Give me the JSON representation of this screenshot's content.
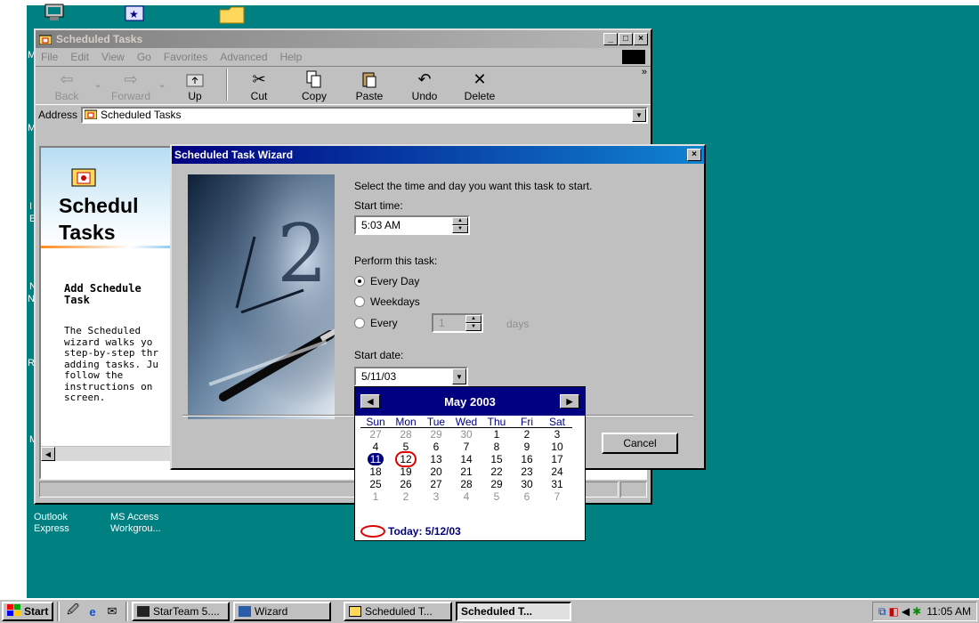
{
  "desktop": {
    "edge_labels": [
      "My",
      "My I",
      "I",
      "E",
      "N",
      "Ne",
      "Re",
      "M"
    ],
    "icons": [
      {
        "label_line1": "Outlook",
        "label_line2": "Express"
      },
      {
        "label_line1": "MS Access",
        "label_line2": "Workgrou..."
      }
    ]
  },
  "explorer": {
    "title": "Scheduled Tasks",
    "menu": [
      "File",
      "Edit",
      "View",
      "Go",
      "Favorites",
      "Advanced",
      "Help"
    ],
    "toolbar": {
      "back": "Back",
      "forward": "Forward",
      "up": "Up",
      "cut": "Cut",
      "copy": "Copy",
      "paste": "Paste",
      "undo": "Undo",
      "delete": "Delete",
      "more": "»"
    },
    "address_label": "Address",
    "address_value": "Scheduled Tasks",
    "left_pane": {
      "title_line1": "Schedul",
      "title_line2": "Tasks",
      "subtitle_line1": "Add Schedule",
      "subtitle_line2": "Task",
      "description": "The Scheduled \nwizard walks yo\nstep-by-step thr\nadding tasks. Ju\nfollow the\ninstructions on \nscreen."
    }
  },
  "wizard": {
    "title": "Scheduled Task Wizard",
    "close": "×",
    "prompt": "Select the time and day you want this task to start.",
    "start_time_label": "Start time:",
    "start_time_value": "5:03 AM",
    "perform_label": "Perform this task:",
    "options": [
      {
        "label": "Every Day",
        "checked": true
      },
      {
        "label": "Weekdays",
        "checked": false
      },
      {
        "label": "Every",
        "checked": false
      }
    ],
    "every_value": "1",
    "every_unit": "days",
    "start_date_label": "Start date:",
    "start_date_value": "5/11/03",
    "cancel_label": "Cancel"
  },
  "calendar": {
    "month_label": "May 2003",
    "days_of_week": [
      "Sun",
      "Mon",
      "Tue",
      "Wed",
      "Thu",
      "Fri",
      "Sat"
    ],
    "weeks": [
      [
        "27",
        "28",
        "29",
        "30",
        "1",
        "2",
        "3"
      ],
      [
        "4",
        "5",
        "6",
        "7",
        "8",
        "9",
        "10"
      ],
      [
        "11",
        "12",
        "13",
        "14",
        "15",
        "16",
        "17"
      ],
      [
        "18",
        "19",
        "20",
        "21",
        "22",
        "23",
        "24"
      ],
      [
        "25",
        "26",
        "27",
        "28",
        "29",
        "30",
        "31"
      ],
      [
        "1",
        "2",
        "3",
        "4",
        "5",
        "6",
        "7"
      ]
    ],
    "selected_day": "11",
    "today_day": "12",
    "today_label": "Today: 5/12/03"
  },
  "taskbar": {
    "start_label": "Start",
    "tasks": [
      {
        "label": "StarTeam 5....",
        "active": false
      },
      {
        "label": "Wizard",
        "active": false
      },
      {
        "label": "Scheduled T...",
        "active": false
      },
      {
        "label": "Scheduled T...",
        "active": true
      }
    ],
    "clock": "11:05 AM"
  },
  "colors": {
    "desktop": "#008080",
    "active_title": "#000080",
    "today_circle": "#dd0000"
  }
}
